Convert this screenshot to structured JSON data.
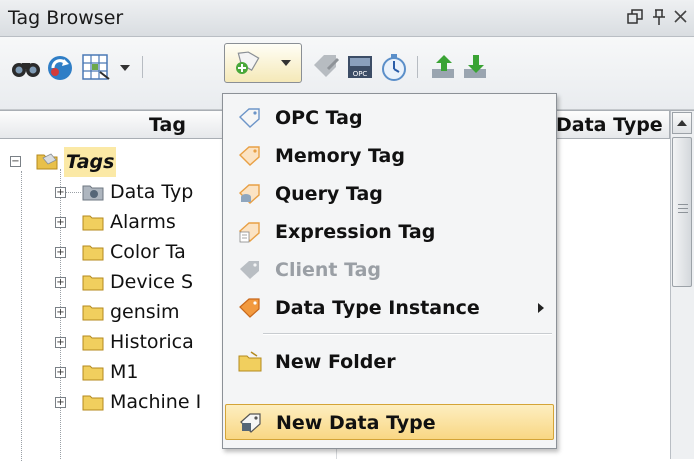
{
  "window": {
    "title": "Tag Browser"
  },
  "table": {
    "columns": [
      "Tag",
      "Data Type"
    ]
  },
  "tree": {
    "root": "Tags",
    "items": [
      "Data Typ",
      "Alarms",
      "Color Ta",
      "Device S",
      "gensim",
      "Historica",
      "M1",
      "Machine I"
    ]
  },
  "menu": {
    "items": [
      {
        "label": "OPC Tag",
        "icon": "opc-tag-icon"
      },
      {
        "label": "Memory Tag",
        "icon": "memory-tag-icon"
      },
      {
        "label": "Query Tag",
        "icon": "query-tag-icon"
      },
      {
        "label": "Expression Tag",
        "icon": "expression-tag-icon"
      },
      {
        "label": "Client Tag",
        "icon": "client-tag-icon",
        "disabled": true
      },
      {
        "label": "Data Type Instance",
        "icon": "data-type-instance-icon",
        "submenu": true
      },
      {
        "label": "New Folder",
        "icon": "new-folder-icon"
      },
      {
        "label": "New Data Type",
        "icon": "new-data-type-icon",
        "selected": true
      }
    ]
  },
  "colors": {
    "highlight": "#f9d784",
    "tags_highlight": "#fbe9a6",
    "folder": "#e8c04a",
    "tag_orange": "#e8a045"
  }
}
